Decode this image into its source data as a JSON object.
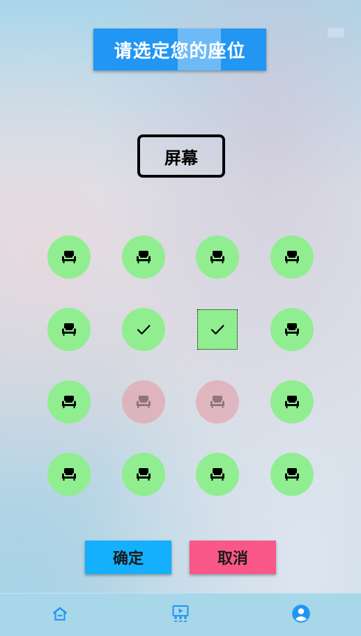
{
  "header": {
    "title": "请选定您的座位"
  },
  "screen": {
    "label": "屏幕"
  },
  "seats": [
    {
      "row": 1,
      "col": 1,
      "status": "available",
      "icon": "sofa-icon"
    },
    {
      "row": 1,
      "col": 2,
      "status": "available",
      "icon": "sofa-icon"
    },
    {
      "row": 1,
      "col": 3,
      "status": "available",
      "icon": "sofa-icon"
    },
    {
      "row": 1,
      "col": 4,
      "status": "available",
      "icon": "sofa-icon"
    },
    {
      "row": 2,
      "col": 1,
      "status": "available",
      "icon": "sofa-icon"
    },
    {
      "row": 2,
      "col": 2,
      "status": "selected",
      "icon": "check-icon"
    },
    {
      "row": 2,
      "col": 3,
      "status": "selected",
      "icon": "check-icon",
      "focused": true
    },
    {
      "row": 2,
      "col": 4,
      "status": "available",
      "icon": "sofa-icon"
    },
    {
      "row": 3,
      "col": 1,
      "status": "available",
      "icon": "sofa-icon"
    },
    {
      "row": 3,
      "col": 2,
      "status": "sold",
      "icon": "sofa-icon"
    },
    {
      "row": 3,
      "col": 3,
      "status": "sold",
      "icon": "sofa-icon"
    },
    {
      "row": 3,
      "col": 4,
      "status": "available",
      "icon": "sofa-icon"
    },
    {
      "row": 4,
      "col": 1,
      "status": "available",
      "icon": "sofa-icon"
    },
    {
      "row": 4,
      "col": 2,
      "status": "available",
      "icon": "sofa-icon"
    },
    {
      "row": 4,
      "col": 3,
      "status": "available",
      "icon": "sofa-icon"
    },
    {
      "row": 4,
      "col": 4,
      "status": "available",
      "icon": "sofa-icon"
    }
  ],
  "actions": {
    "confirm_label": "确定",
    "cancel_label": "取消"
  },
  "bottom_nav": {
    "items": [
      {
        "name": "home",
        "icon": "home-icon"
      },
      {
        "name": "cinema",
        "icon": "cinema-icon"
      },
      {
        "name": "profile",
        "icon": "profile-icon"
      }
    ]
  },
  "colors": {
    "title_bg": "#2196f3",
    "seat_available": "#90ee90",
    "seat_sold": "#e696a0",
    "confirm_bg": "#14b0fd",
    "cancel_bg": "#fa5789",
    "nav_bg": "#a8d7ea",
    "nav_icon": "#2196f3"
  }
}
